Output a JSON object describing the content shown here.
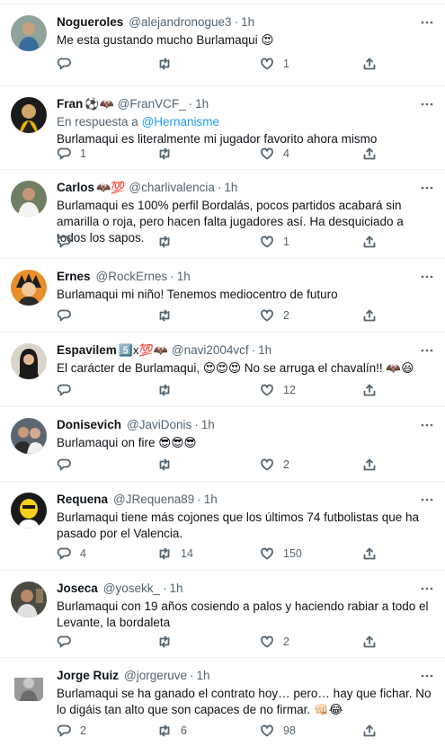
{
  "tweets": [
    {
      "name": "Nogueroles",
      "badges": "",
      "handle": "@alejandronogue3",
      "time": "1h",
      "reply_to_label": "",
      "reply_to_handle": "",
      "text": "Me esta gustando mucho Burlamaqui 😍",
      "replies": "",
      "retweets": "",
      "likes": "1"
    },
    {
      "name": "Fran",
      "badges": "⚽🦇",
      "handle": "@FranVCF_",
      "time": "1h",
      "reply_to_label": "En respuesta a ",
      "reply_to_handle": "@Hernanisme",
      "text": "Burlamaqui es literalmente mi jugador favorito ahora mismo",
      "replies": "1",
      "retweets": "",
      "likes": "4"
    },
    {
      "name": "Carlos",
      "badges": "🦇💯",
      "handle": "@charlivalencia",
      "time": "1h",
      "reply_to_label": "",
      "reply_to_handle": "",
      "text": "Burlamaqui es 100% perfil Bordalás, pocos partidos acabará sin amarilla o roja, pero hacen falta jugadores así. Ha desquiciado a todos los sapos.",
      "replies": "",
      "retweets": "",
      "likes": "1"
    },
    {
      "name": "Ernes",
      "badges": "",
      "handle": "@RockErnes",
      "time": "1h",
      "reply_to_label": "",
      "reply_to_handle": "",
      "text": "Burlamaqui mi niño! Tenemos mediocentro de futuro",
      "replies": "",
      "retweets": "",
      "likes": "2"
    },
    {
      "name": "Espavilem",
      "badges": "5️⃣x💯🦇",
      "handle": "@navi2004vcf",
      "time": "1h",
      "reply_to_label": "",
      "reply_to_handle": "",
      "text": "El carácter de Burlamaqui, 😍😍😍 No se arruga el chavalín!! 🦇😃",
      "replies": "",
      "retweets": "",
      "likes": "12"
    },
    {
      "name": "Donisevich",
      "badges": "",
      "handle": "@JaviDonis",
      "time": "1h",
      "reply_to_label": "",
      "reply_to_handle": "",
      "text": "Burlamaqui on fire 😎😎😎",
      "replies": "",
      "retweets": "",
      "likes": "2"
    },
    {
      "name": "Requena",
      "badges": "",
      "handle": "@JRequena89",
      "time": "1h",
      "reply_to_label": "",
      "reply_to_handle": "",
      "text": "Burlamaqui tiene más cojones que los últimos 74 futbolistas que ha pasado por el Valencia.",
      "replies": "4",
      "retweets": "14",
      "likes": "150"
    },
    {
      "name": "Joseca",
      "badges": "",
      "handle": "@yosekk_",
      "time": "1h",
      "reply_to_label": "",
      "reply_to_handle": "",
      "text": "Burlamaqui con 19 años cosiendo a palos y haciendo rabiar a todo el Levante, la bordaleta",
      "replies": "",
      "retweets": "",
      "likes": "2"
    },
    {
      "name": "Jorge Ruiz",
      "badges": "",
      "handle": "@jorgeruve",
      "time": "1h",
      "reply_to_label": "",
      "reply_to_handle": "",
      "text": "Burlamaqui se ha ganado el contrato hoy… pero… hay que fichar. No lo digáis tan alto que son capaces de no firmar. 👊🏻😂",
      "replies": "2",
      "retweets": "6",
      "likes": "98"
    }
  ]
}
